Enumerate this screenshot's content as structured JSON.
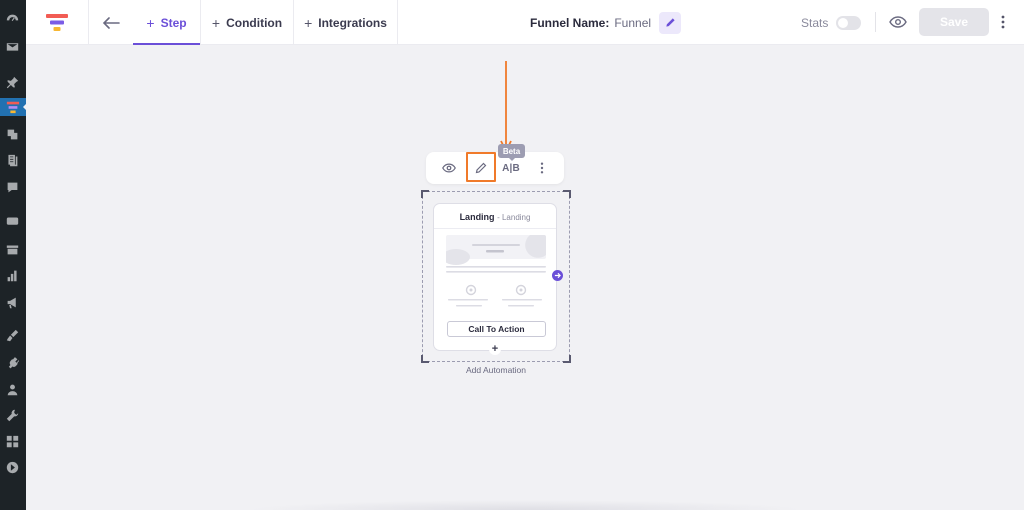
{
  "header": {
    "back_icon": "arrow-left-icon",
    "tabs": [
      {
        "label": "Step",
        "active": true
      },
      {
        "label": "Condition",
        "active": false
      },
      {
        "label": "Integrations",
        "active": false
      }
    ],
    "funnel_name_label": "Funnel Name:",
    "funnel_name_value": "Funnel",
    "stats_label": "Stats",
    "stats_enabled": false,
    "save_label": "Save"
  },
  "canvas": {
    "toolbar": {
      "ab_label": "A|B",
      "beta_label": "Beta"
    },
    "node": {
      "title": "Landing",
      "subtitle": "- Landing",
      "cta_label": "Call To Action"
    },
    "add_automation_label": "Add Automation"
  },
  "colors": {
    "accent": "#6b4fd8",
    "highlight": "#f07a2a",
    "wp_sidebar": "#1d2327",
    "wp_active": "#2271b1"
  }
}
